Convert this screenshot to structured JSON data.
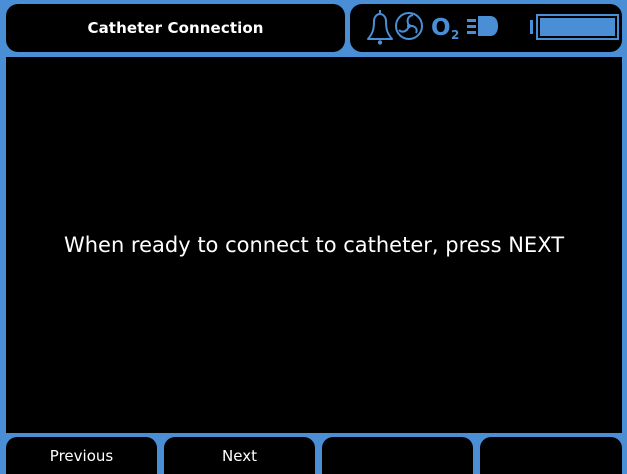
{
  "header": {
    "title": "Catheter Connection"
  },
  "status_icons": [
    {
      "name": "alarm-bell-icon"
    },
    {
      "name": "fan-icon"
    },
    {
      "name": "oxygen-icon",
      "label": "O",
      "subscript": "2"
    },
    {
      "name": "ac-power-plug-icon"
    },
    {
      "name": "battery-icon"
    }
  ],
  "main": {
    "message": "When ready to connect to catheter, press NEXT"
  },
  "softkeys": [
    {
      "label": "Previous"
    },
    {
      "label": "Next"
    },
    {
      "label": ""
    },
    {
      "label": ""
    }
  ],
  "colors": {
    "accent": "#4a8fd6",
    "panel": "#000000",
    "text": "#ffffff"
  }
}
